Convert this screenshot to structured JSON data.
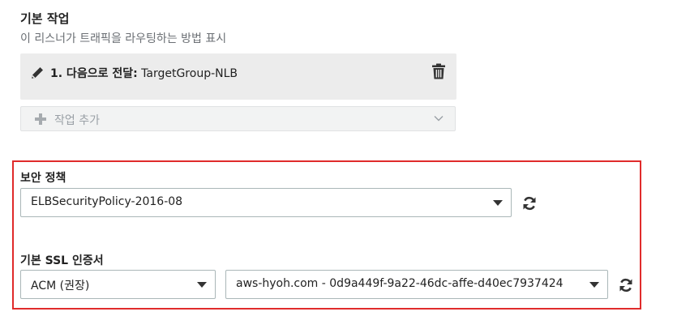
{
  "default_actions": {
    "title": "기본 작업",
    "description": "이 리스너가 트래픽을 라우팅하는 방법 표시",
    "action_item": {
      "prefix": "1. 다음으로 전달:",
      "target": "TargetGroup-NLB"
    },
    "add_action_label": "작업 추가"
  },
  "security_policy": {
    "label": "보안 정책",
    "selected": "ELBSecurityPolicy-2016-08"
  },
  "ssl_certificate": {
    "label": "기본 SSL 인증서",
    "source_selected": "ACM (권장)",
    "certificate_selected": "aws-hyoh.com - 0d9a449f-9a22-46dc-affe-d40ec7937424"
  },
  "colors": {
    "highlight_border": "#e02b2b",
    "action_background": "#ececec"
  },
  "icons": {
    "edit": "pencil-icon",
    "delete": "trash-icon",
    "add": "plus-icon",
    "expand": "chevron-down-icon",
    "dropdown": "caret-down-icon",
    "refresh": "refresh-icon"
  }
}
